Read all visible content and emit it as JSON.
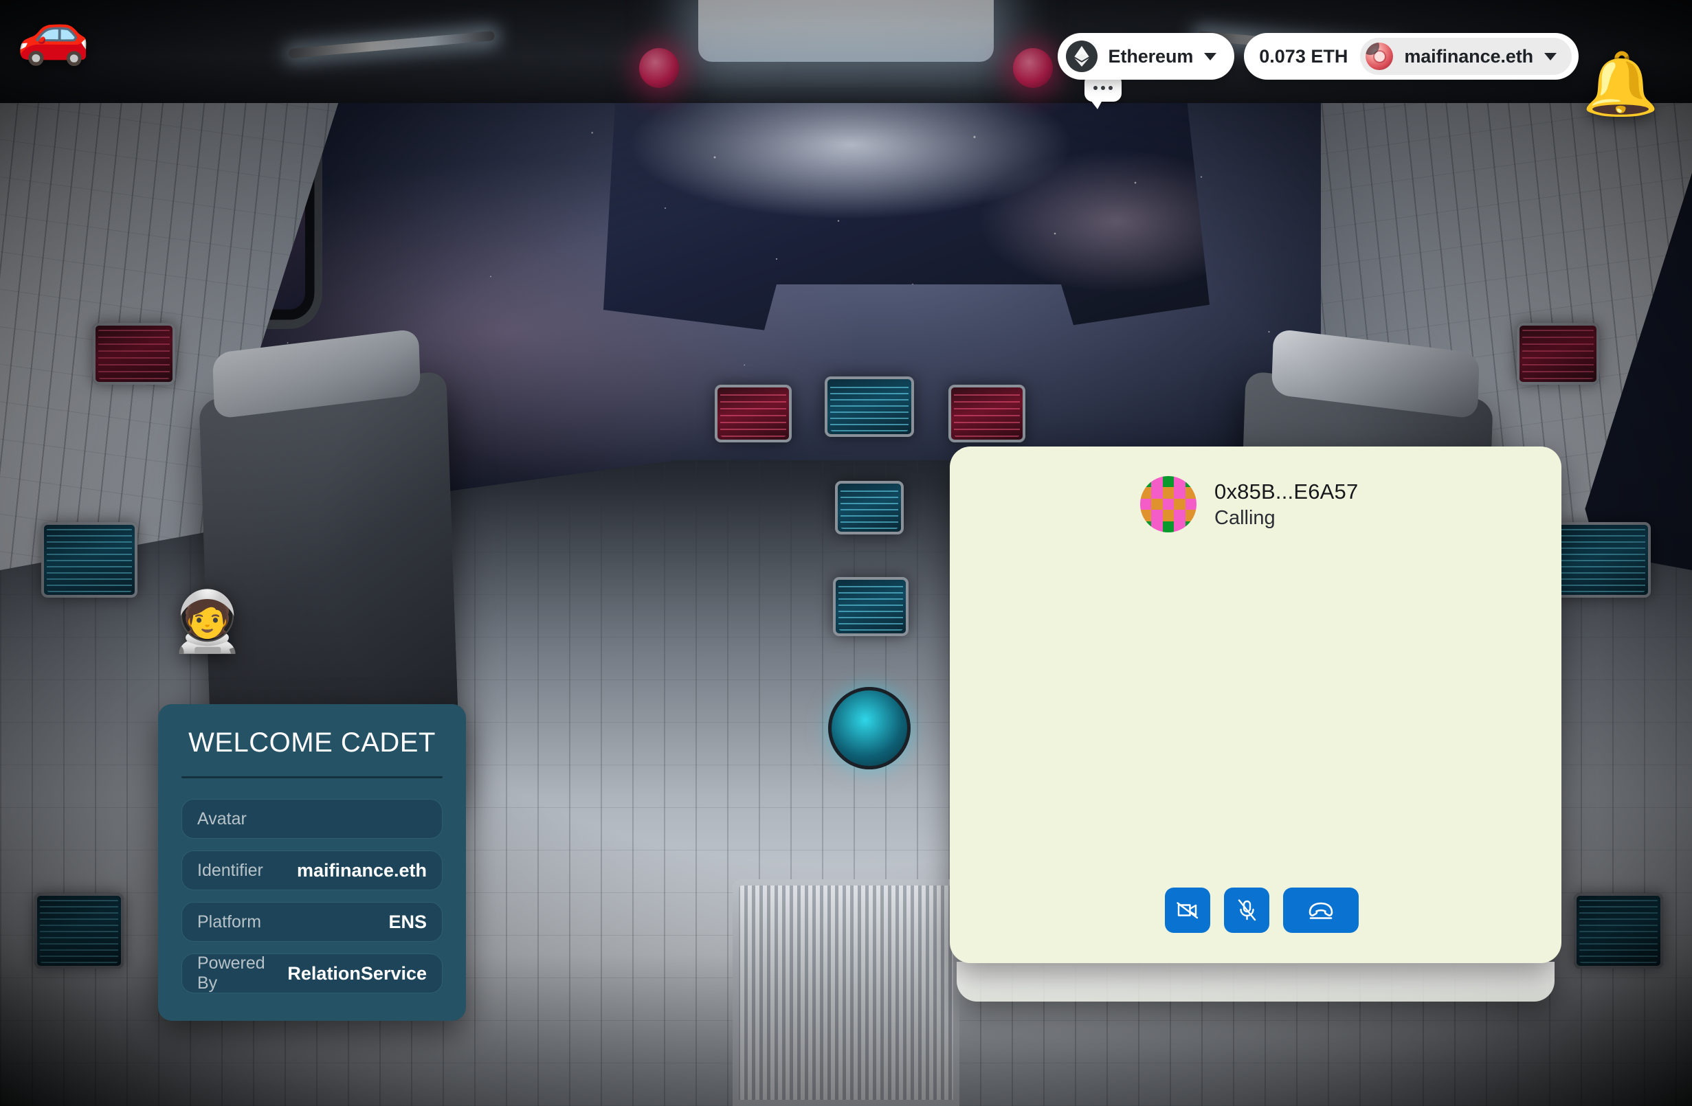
{
  "topbar": {
    "car_icon": "red-sports-car",
    "bell_icon": "bell",
    "chat_icon": "chat-bubble-ellipsis",
    "astronaut_icon": "astronaut",
    "network": {
      "label": "Ethereum",
      "icon": "ethereum-logo",
      "chevron": "chevron-down"
    },
    "balance": "0.073 ETH",
    "account": {
      "name": "maifinance.eth",
      "avatar": "pink-token-avatar",
      "chevron": "chevron-down"
    }
  },
  "welcome_card": {
    "title": "WELCOME CADET",
    "rows": [
      {
        "key": "Avatar",
        "value": ""
      },
      {
        "key": "Identifier",
        "value": "maifinance.eth"
      },
      {
        "key": "Platform",
        "value": "ENS"
      },
      {
        "key": "Powered By",
        "value": "RelationService"
      }
    ]
  },
  "call_panel": {
    "caller_address": "0x85B...E6A57",
    "status": "Calling",
    "identicon": {
      "colors": {
        "pink": "#F45CC8",
        "orange": "#E0922F",
        "green": "#09992D"
      },
      "grid": [
        "green",
        "pink",
        "green",
        "pink",
        "green",
        "orange",
        "pink",
        "orange",
        "pink",
        "orange",
        "pink",
        "orange",
        "pink",
        "orange",
        "pink",
        "orange",
        "pink",
        "orange",
        "pink",
        "orange",
        "green",
        "pink",
        "green",
        "pink",
        "green"
      ]
    },
    "controls": [
      {
        "name": "video-off-button",
        "icon": "video-camera-slash-icon",
        "label": "Turn camera off"
      },
      {
        "name": "mic-off-button",
        "icon": "microphone-slash-icon",
        "label": "Mute microphone"
      },
      {
        "name": "hangup-button",
        "icon": "phone-down-icon",
        "label": "End call"
      }
    ],
    "colors": {
      "panel_bg": "#F1F4DD",
      "button_bg": "#0A72D0"
    }
  },
  "theme": {
    "card_bg": "#255264",
    "card_row_bg": "#1D4458",
    "accent_blue": "#0A72D0"
  }
}
